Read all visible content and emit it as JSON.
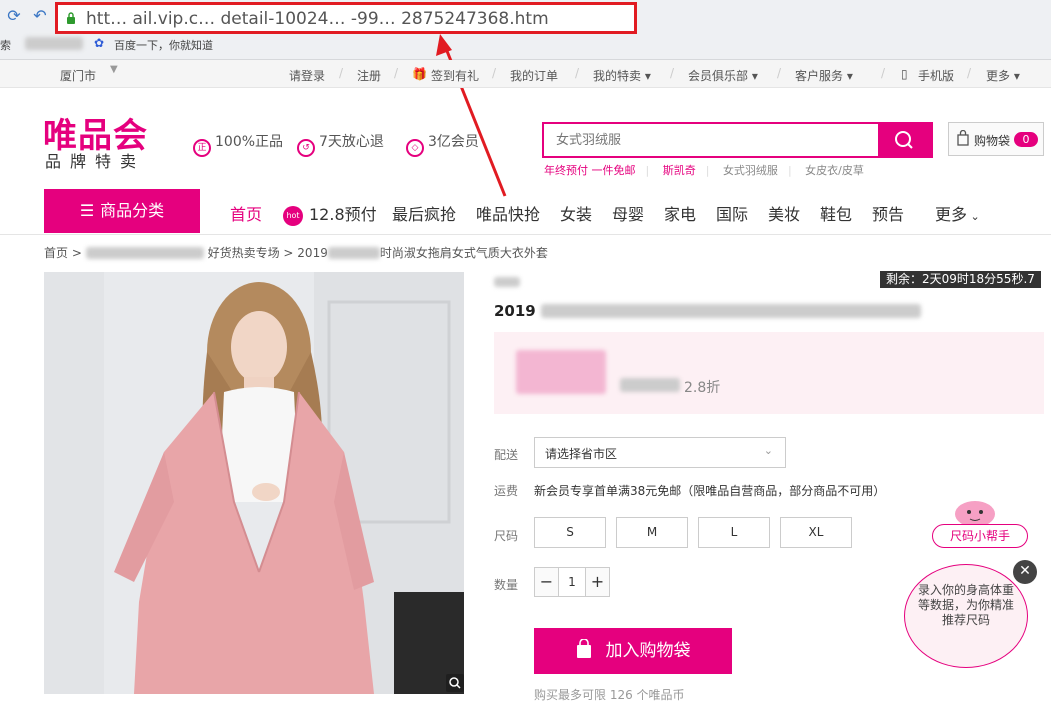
{
  "browser": {
    "url_visible": "htt… ail.vip.c… detail-10024… -99… 2875247368.htm",
    "bookmarks": [
      "索",
      "百度一下，你就知道"
    ]
  },
  "topbar": {
    "city": "厦门市",
    "links": [
      "请登录",
      "注册",
      "签到有礼",
      "我的订单",
      "我的特卖 ▾",
      "会员俱乐部 ▾",
      "客户服务 ▾",
      "手机版",
      "更多 ▾"
    ]
  },
  "header": {
    "logo_main": "唯品会",
    "logo_sub": "品牌特卖",
    "promises": [
      "100%正品",
      "7天放心退",
      "3亿会员"
    ],
    "search_placeholder": "女式羽绒服",
    "hot_words": [
      "年终预付 一件免邮",
      "斯凯奇",
      "女式羽绒服",
      "女皮衣/皮草"
    ],
    "cart_label": "购物袋",
    "cart_count": "0"
  },
  "nav": {
    "category_label": "商品分类",
    "items": [
      "首页",
      "12.8预付",
      "最后疯抢",
      "唯品快抢",
      "女装",
      "母婴",
      "家电",
      "国际",
      "美妆",
      "鞋包",
      "预告",
      "更多"
    ],
    "hot_badge": "hot"
  },
  "breadcrumb": {
    "home": "首页",
    "sep": ">",
    "crumb2": "好货热卖专场",
    "crumb3_start": "2019",
    "crumb3_end": "时尚淑女拖肩女式气质大衣外套"
  },
  "product": {
    "countdown": "剩余：2天09时18分55秒.7",
    "title_start": "2019",
    "discount": "2.8折",
    "delivery_label": "配送",
    "delivery_select": "请选择省市区",
    "freight_label": "运费",
    "freight_text": "新会员专享首单满38元免邮（限唯品自营商品，部分商品不可用）",
    "size_label": "尺码",
    "sizes": [
      "S",
      "M",
      "L",
      "XL"
    ],
    "qty_label": "数量",
    "qty_minus": "−",
    "qty_value": "1",
    "qty_plus": "+",
    "add_to_cart": "加入购物袋",
    "buy_limit": "购买最多可限 126 个唯品币"
  },
  "size_helper": {
    "title": "尺码小帮手",
    "text": "录入你的身高体重等数据，为你精准推荐尺码",
    "close": "✕"
  },
  "colors": {
    "brand": "#e5007e",
    "annotation": "#e11b22"
  }
}
